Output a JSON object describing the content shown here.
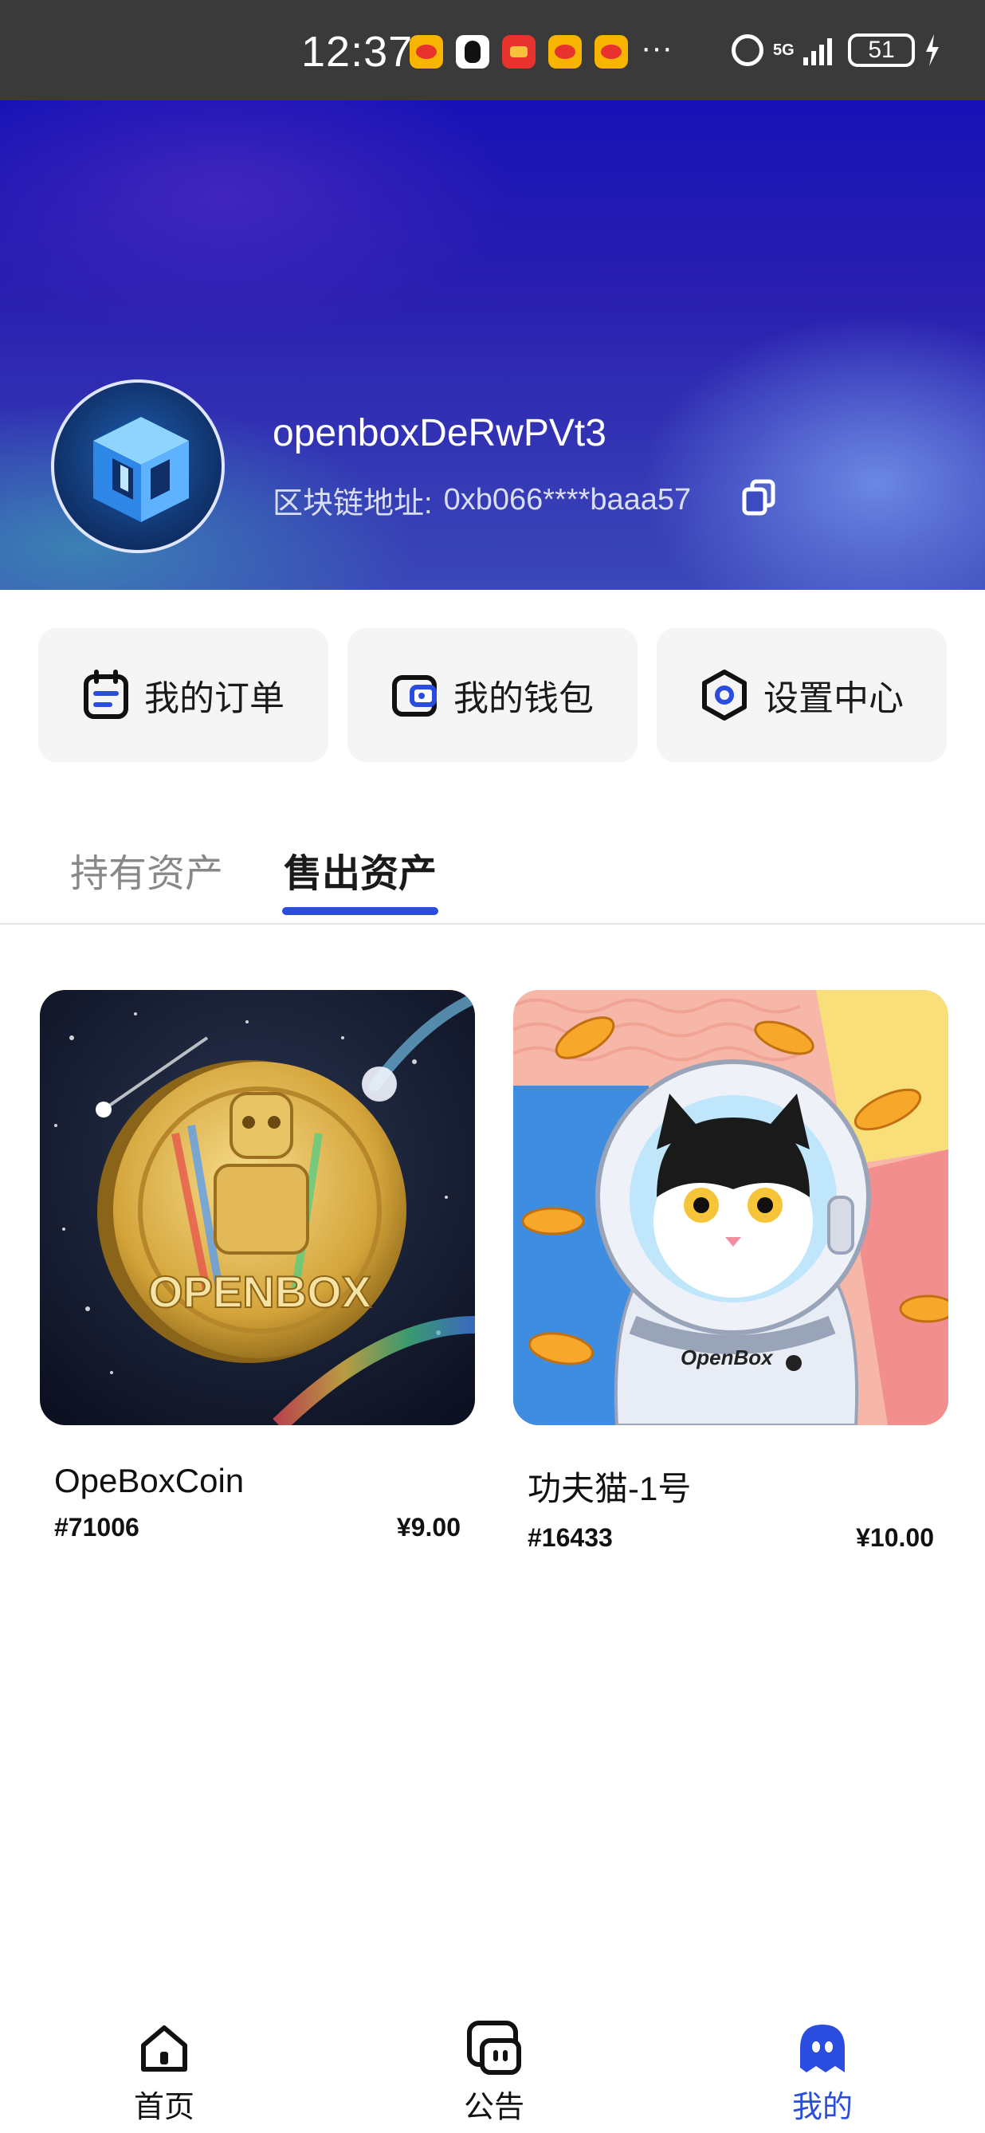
{
  "status_bar": {
    "time": "12:37",
    "overflow": "···",
    "network": "5G",
    "battery": "51",
    "app_icons": [
      "weibo-icon",
      "qq-icon",
      "red-envelope-icon",
      "weibo-icon",
      "weibo-icon"
    ]
  },
  "profile": {
    "username": "openboxDeRwPVt3",
    "address_label": "区块链地址:",
    "address_value": "0xb066****baaa57"
  },
  "actions": [
    {
      "label": "我的订单",
      "icon": "order-icon"
    },
    {
      "label": "我的钱包",
      "icon": "wallet-icon"
    },
    {
      "label": "设置中心",
      "icon": "settings-icon"
    }
  ],
  "tabs": [
    {
      "label": "持有资产",
      "active": false
    },
    {
      "label": "售出资产",
      "active": true
    }
  ],
  "assets": [
    {
      "name": "OpeBoxCoin",
      "id": "#71006",
      "price": "¥9.00",
      "image_text": "OPENBOX"
    },
    {
      "name": "功夫猫-1号",
      "id": "#16433",
      "price": "¥10.00",
      "image_text": "OpenBox"
    }
  ],
  "bottom_nav": [
    {
      "label": "首页",
      "icon": "home-icon",
      "active": false
    },
    {
      "label": "公告",
      "icon": "notice-icon",
      "active": false
    },
    {
      "label": "我的",
      "icon": "profile-icon",
      "active": true
    }
  ],
  "colors": {
    "accent": "#2b4ddf",
    "header_top": "#1712b6",
    "card_bg": "#f5f5f5"
  }
}
